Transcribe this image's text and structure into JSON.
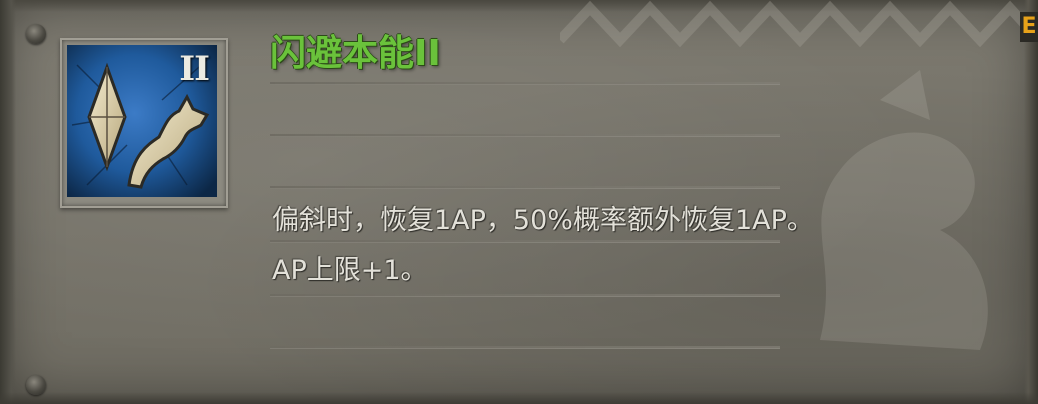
{
  "skill": {
    "name": "闪避本能II",
    "rank": "II",
    "icon": "crystal-and-horse-head-icon",
    "description_lines": [
      "偏斜时，恢复1AP，50%概率额外恢复1AP。",
      "AP上限+1。"
    ]
  },
  "corner_tab": {
    "label": "E"
  },
  "colors": {
    "title_green": "#6ac23b",
    "icon_blue": "#1f5a9c",
    "parchment": "#77746a",
    "text": "#e3e1d9"
  }
}
